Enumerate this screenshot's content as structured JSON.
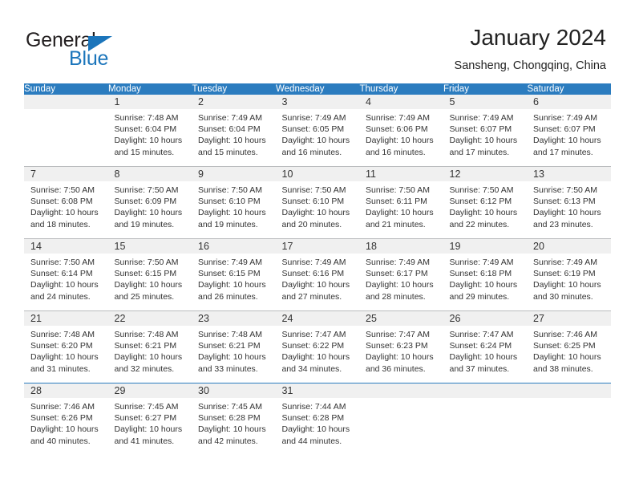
{
  "brand": {
    "name_top": "General",
    "name_bottom": "Blue",
    "accent_color": "#1b75bb"
  },
  "header": {
    "title": "January 2024",
    "location": "Sansheng, Chongqing, China",
    "header_bg_color": "#2b7cbf",
    "daynum_band_color": "#f0f0f0"
  },
  "calendar": {
    "weekday_headers": [
      "Sunday",
      "Monday",
      "Tuesday",
      "Wednesday",
      "Thursday",
      "Friday",
      "Saturday"
    ],
    "weeks": [
      [
        {
          "day": "",
          "sunrise": "",
          "sunset": "",
          "daylight_line1": "",
          "daylight_line2": ""
        },
        {
          "day": "1",
          "sunrise": "Sunrise: 7:48 AM",
          "sunset": "Sunset: 6:04 PM",
          "daylight_line1": "Daylight: 10 hours",
          "daylight_line2": "and 15 minutes."
        },
        {
          "day": "2",
          "sunrise": "Sunrise: 7:49 AM",
          "sunset": "Sunset: 6:04 PM",
          "daylight_line1": "Daylight: 10 hours",
          "daylight_line2": "and 15 minutes."
        },
        {
          "day": "3",
          "sunrise": "Sunrise: 7:49 AM",
          "sunset": "Sunset: 6:05 PM",
          "daylight_line1": "Daylight: 10 hours",
          "daylight_line2": "and 16 minutes."
        },
        {
          "day": "4",
          "sunrise": "Sunrise: 7:49 AM",
          "sunset": "Sunset: 6:06 PM",
          "daylight_line1": "Daylight: 10 hours",
          "daylight_line2": "and 16 minutes."
        },
        {
          "day": "5",
          "sunrise": "Sunrise: 7:49 AM",
          "sunset": "Sunset: 6:07 PM",
          "daylight_line1": "Daylight: 10 hours",
          "daylight_line2": "and 17 minutes."
        },
        {
          "day": "6",
          "sunrise": "Sunrise: 7:49 AM",
          "sunset": "Sunset: 6:07 PM",
          "daylight_line1": "Daylight: 10 hours",
          "daylight_line2": "and 17 minutes."
        }
      ],
      [
        {
          "day": "7",
          "sunrise": "Sunrise: 7:50 AM",
          "sunset": "Sunset: 6:08 PM",
          "daylight_line1": "Daylight: 10 hours",
          "daylight_line2": "and 18 minutes."
        },
        {
          "day": "8",
          "sunrise": "Sunrise: 7:50 AM",
          "sunset": "Sunset: 6:09 PM",
          "daylight_line1": "Daylight: 10 hours",
          "daylight_line2": "and 19 minutes."
        },
        {
          "day": "9",
          "sunrise": "Sunrise: 7:50 AM",
          "sunset": "Sunset: 6:10 PM",
          "daylight_line1": "Daylight: 10 hours",
          "daylight_line2": "and 19 minutes."
        },
        {
          "day": "10",
          "sunrise": "Sunrise: 7:50 AM",
          "sunset": "Sunset: 6:10 PM",
          "daylight_line1": "Daylight: 10 hours",
          "daylight_line2": "and 20 minutes."
        },
        {
          "day": "11",
          "sunrise": "Sunrise: 7:50 AM",
          "sunset": "Sunset: 6:11 PM",
          "daylight_line1": "Daylight: 10 hours",
          "daylight_line2": "and 21 minutes."
        },
        {
          "day": "12",
          "sunrise": "Sunrise: 7:50 AM",
          "sunset": "Sunset: 6:12 PM",
          "daylight_line1": "Daylight: 10 hours",
          "daylight_line2": "and 22 minutes."
        },
        {
          "day": "13",
          "sunrise": "Sunrise: 7:50 AM",
          "sunset": "Sunset: 6:13 PM",
          "daylight_line1": "Daylight: 10 hours",
          "daylight_line2": "and 23 minutes."
        }
      ],
      [
        {
          "day": "14",
          "sunrise": "Sunrise: 7:50 AM",
          "sunset": "Sunset: 6:14 PM",
          "daylight_line1": "Daylight: 10 hours",
          "daylight_line2": "and 24 minutes."
        },
        {
          "day": "15",
          "sunrise": "Sunrise: 7:50 AM",
          "sunset": "Sunset: 6:15 PM",
          "daylight_line1": "Daylight: 10 hours",
          "daylight_line2": "and 25 minutes."
        },
        {
          "day": "16",
          "sunrise": "Sunrise: 7:49 AM",
          "sunset": "Sunset: 6:15 PM",
          "daylight_line1": "Daylight: 10 hours",
          "daylight_line2": "and 26 minutes."
        },
        {
          "day": "17",
          "sunrise": "Sunrise: 7:49 AM",
          "sunset": "Sunset: 6:16 PM",
          "daylight_line1": "Daylight: 10 hours",
          "daylight_line2": "and 27 minutes."
        },
        {
          "day": "18",
          "sunrise": "Sunrise: 7:49 AM",
          "sunset": "Sunset: 6:17 PM",
          "daylight_line1": "Daylight: 10 hours",
          "daylight_line2": "and 28 minutes."
        },
        {
          "day": "19",
          "sunrise": "Sunrise: 7:49 AM",
          "sunset": "Sunset: 6:18 PM",
          "daylight_line1": "Daylight: 10 hours",
          "daylight_line2": "and 29 minutes."
        },
        {
          "day": "20",
          "sunrise": "Sunrise: 7:49 AM",
          "sunset": "Sunset: 6:19 PM",
          "daylight_line1": "Daylight: 10 hours",
          "daylight_line2": "and 30 minutes."
        }
      ],
      [
        {
          "day": "21",
          "sunrise": "Sunrise: 7:48 AM",
          "sunset": "Sunset: 6:20 PM",
          "daylight_line1": "Daylight: 10 hours",
          "daylight_line2": "and 31 minutes."
        },
        {
          "day": "22",
          "sunrise": "Sunrise: 7:48 AM",
          "sunset": "Sunset: 6:21 PM",
          "daylight_line1": "Daylight: 10 hours",
          "daylight_line2": "and 32 minutes."
        },
        {
          "day": "23",
          "sunrise": "Sunrise: 7:48 AM",
          "sunset": "Sunset: 6:21 PM",
          "daylight_line1": "Daylight: 10 hours",
          "daylight_line2": "and 33 minutes."
        },
        {
          "day": "24",
          "sunrise": "Sunrise: 7:47 AM",
          "sunset": "Sunset: 6:22 PM",
          "daylight_line1": "Daylight: 10 hours",
          "daylight_line2": "and 34 minutes."
        },
        {
          "day": "25",
          "sunrise": "Sunrise: 7:47 AM",
          "sunset": "Sunset: 6:23 PM",
          "daylight_line1": "Daylight: 10 hours",
          "daylight_line2": "and 36 minutes."
        },
        {
          "day": "26",
          "sunrise": "Sunrise: 7:47 AM",
          "sunset": "Sunset: 6:24 PM",
          "daylight_line1": "Daylight: 10 hours",
          "daylight_line2": "and 37 minutes."
        },
        {
          "day": "27",
          "sunrise": "Sunrise: 7:46 AM",
          "sunset": "Sunset: 6:25 PM",
          "daylight_line1": "Daylight: 10 hours",
          "daylight_line2": "and 38 minutes."
        }
      ],
      [
        {
          "day": "28",
          "sunrise": "Sunrise: 7:46 AM",
          "sunset": "Sunset: 6:26 PM",
          "daylight_line1": "Daylight: 10 hours",
          "daylight_line2": "and 40 minutes."
        },
        {
          "day": "29",
          "sunrise": "Sunrise: 7:45 AM",
          "sunset": "Sunset: 6:27 PM",
          "daylight_line1": "Daylight: 10 hours",
          "daylight_line2": "and 41 minutes."
        },
        {
          "day": "30",
          "sunrise": "Sunrise: 7:45 AM",
          "sunset": "Sunset: 6:28 PM",
          "daylight_line1": "Daylight: 10 hours",
          "daylight_line2": "and 42 minutes."
        },
        {
          "day": "31",
          "sunrise": "Sunrise: 7:44 AM",
          "sunset": "Sunset: 6:28 PM",
          "daylight_line1": "Daylight: 10 hours",
          "daylight_line2": "and 44 minutes."
        },
        {
          "day": "",
          "sunrise": "",
          "sunset": "",
          "daylight_line1": "",
          "daylight_line2": ""
        },
        {
          "day": "",
          "sunrise": "",
          "sunset": "",
          "daylight_line1": "",
          "daylight_line2": ""
        },
        {
          "day": "",
          "sunrise": "",
          "sunset": "",
          "daylight_line1": "",
          "daylight_line2": ""
        }
      ]
    ]
  }
}
